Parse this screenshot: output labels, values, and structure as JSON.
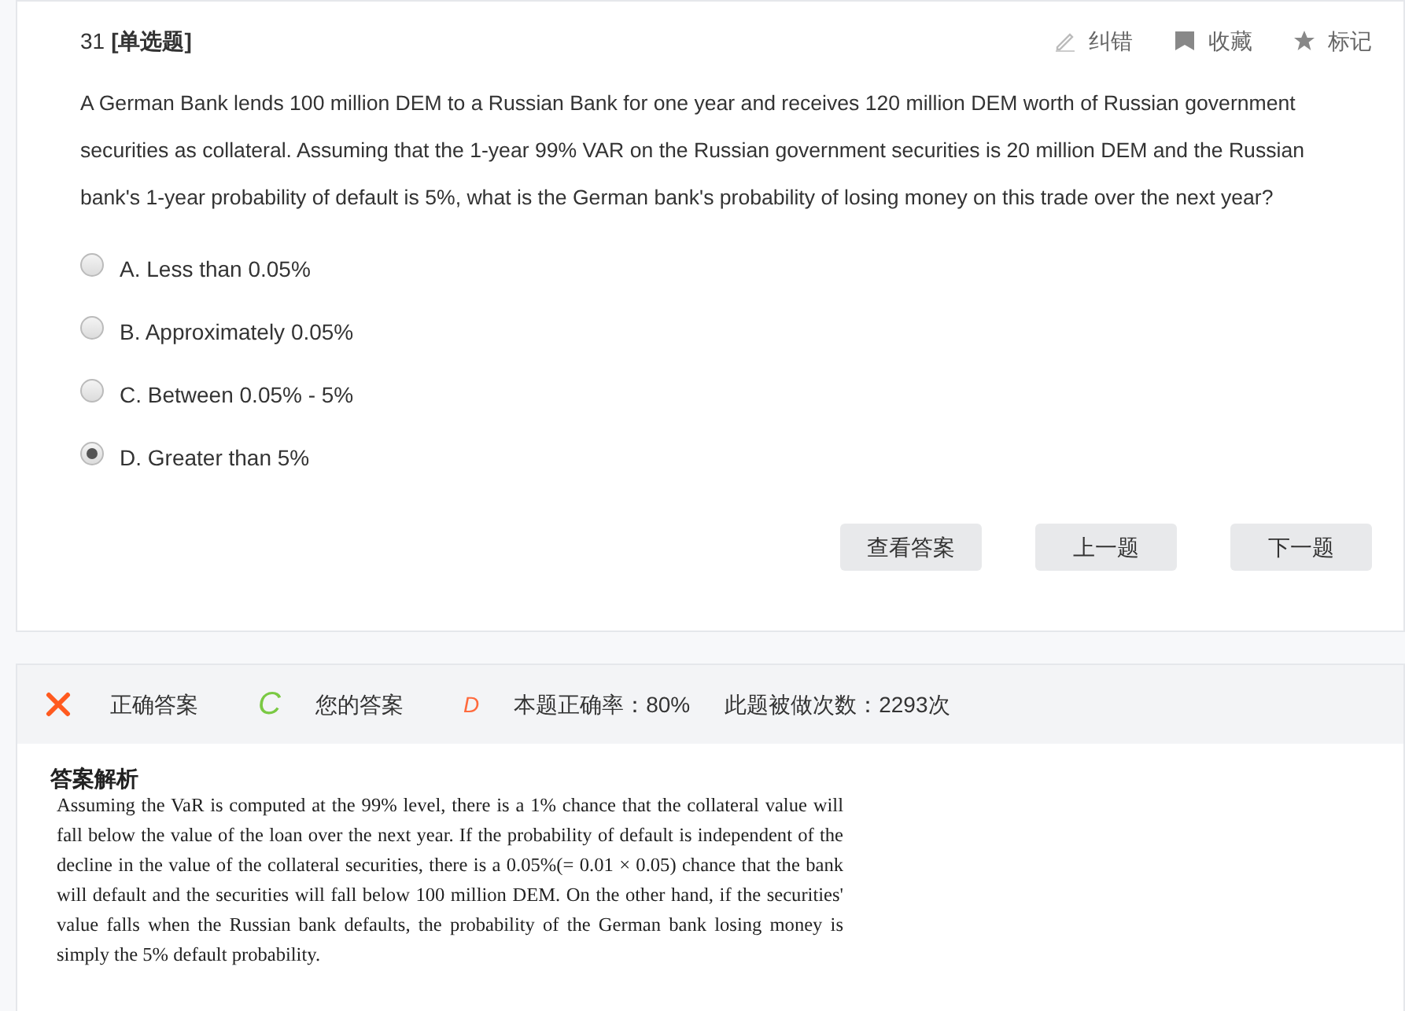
{
  "question": {
    "number": "31",
    "type": "[单选题]",
    "actions": [
      {
        "kind": "edit",
        "label": "纠错"
      },
      {
        "kind": "bookmark",
        "label": "收藏"
      },
      {
        "kind": "star",
        "label": "标记"
      }
    ],
    "text": " A German Bank lends 100 million DEM to a Russian Bank for one year and receives 120 million DEM worth of Russian government securities as collateral. Assuming that the 1-year 99% VAR on the Russian government securities is 20 million DEM and the Russian bank's 1-year probability of default is 5%, what is the German bank's probability of losing money on this trade over the next year?",
    "options": [
      {
        "label": "A. Less than 0.05%",
        "selected": false
      },
      {
        "label": "B. Approximately 0.05%",
        "selected": false
      },
      {
        "label": "C. Between 0.05% - 5%",
        "selected": false
      },
      {
        "label": "D. Greater than 5%",
        "selected": true
      }
    ],
    "buttons": [
      "查看答案",
      "上一题",
      "下一题"
    ]
  },
  "result": {
    "correct": false,
    "correct_answer": "C",
    "correct_answer_label": "正确答案",
    "your_answer": "D",
    "your_answer_label": "您的答案",
    "accuracy": "本题正确率：80%",
    "attempts": "此题被做次数：2293次"
  },
  "explanation": {
    "title": "答案解析",
    "text": "Assuming the VaR is computed at the 99% level, there is a 1% chance that the collateral value will fall below the value of the loan over the next year. If the probability of default is independent of the decline in the value of the collateral securities, there is a  0.05%(= 0.01 × 0.05)  chance that the bank will default and the securities will fall below 100 million DEM. On the other hand, if the securities' value falls when the Russian bank defaults, the probability of the German bank losing money is simply the 5% default probability."
  }
}
